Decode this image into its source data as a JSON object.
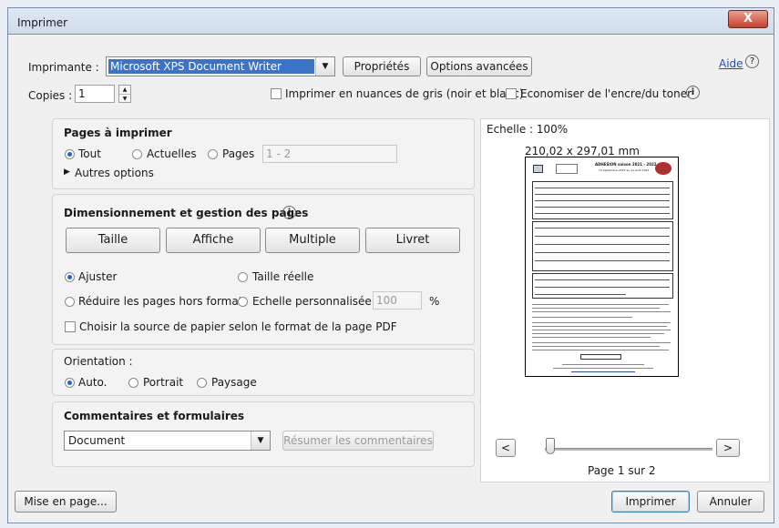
{
  "window": {
    "title": "Imprimer",
    "close_glyph": "X"
  },
  "printer": {
    "label": "Imprimante :",
    "selected": "Microsoft XPS Document Writer",
    "properties_button": "Propriétés",
    "advanced_button": "Options avancées",
    "help_link": "Aide",
    "help_icon": "question-circle-icon"
  },
  "copies": {
    "label": "Copies :",
    "value": "1",
    "grayscale_label": "Imprimer en nuances de gris (noir et blanc)",
    "save_ink_label": "Economiser de l'encre/du toner",
    "info_icon": "info-circle-icon"
  },
  "pages_section": {
    "title": "Pages à imprimer",
    "all_label": "Tout",
    "current_label": "Actuelles",
    "pages_label": "Pages",
    "pages_value": "1 - 2",
    "more_options": "Autres options",
    "selected": "Tout"
  },
  "sizing_section": {
    "title": "Dimensionnement et gestion des pages",
    "size_button": "Taille",
    "poster_button": "Affiche",
    "multiple_button": "Multiple",
    "booklet_button": "Livret",
    "fit_label": "Ajuster",
    "actual_size_label": "Taille réelle",
    "shrink_label": "Réduire les pages hors format",
    "custom_scale_label": "Echelle personnalisée :",
    "custom_scale_value": "100",
    "percent_symbol": "%",
    "paper_source_label": "Choisir la source de papier selon le format de la page PDF",
    "selected": "Ajuster"
  },
  "orientation_section": {
    "title": "Orientation :",
    "auto_label": "Auto.",
    "portrait_label": "Portrait",
    "landscape_label": "Paysage",
    "selected": "Auto."
  },
  "comments_section": {
    "title": "Commentaires et formulaires",
    "selected": "Document",
    "summarize_button": "Résumer les commentaires"
  },
  "preview": {
    "scale_label": "Echelle : 100%",
    "page_size": "210,02 x 297,01 mm",
    "prev_button": "<",
    "next_button": ">",
    "page_indicator": "Page 1 sur 2",
    "doc_heading": "ADHESION saison 2021 - 2022",
    "doc_subheading": "13 septembre 2021 au 21 août 2022"
  },
  "footer": {
    "page_setup_button": "Mise en page...",
    "print_button": "Imprimer",
    "cancel_button": "Annuler"
  }
}
